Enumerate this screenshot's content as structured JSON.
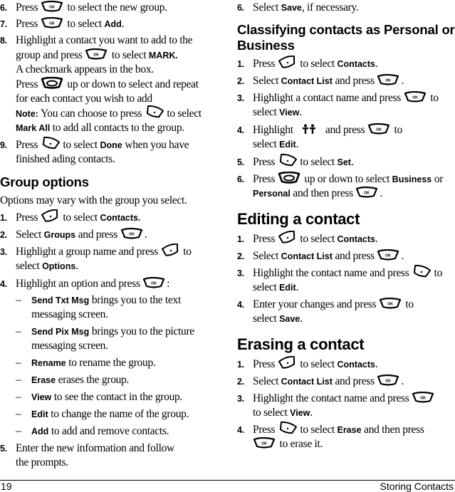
{
  "icons": {
    "ok": "ok-key",
    "left_soft": "left-soft-key",
    "right_soft": "right-soft-key",
    "nav": "navigation-key",
    "contact_type": "contact-type-icon"
  },
  "ok_label": "OK",
  "left_column": {
    "steps_top": [
      {
        "num": "6.",
        "pre": "Press",
        "post": "to select the new group."
      },
      {
        "num": "7.",
        "pre": "Press",
        "post": "to select",
        "bold": "Add",
        "end": "."
      },
      {
        "num": "8.",
        "l1": "Highlight a contact you want to add to the",
        "l2_pre": "group and press",
        "l2_post": "to select",
        "l2_bold": "MARK.",
        "l3": "A checkmark appears in the box.",
        "l4_pre": "Press",
        "l4_post": "up or down to select and repeat",
        "l5": "for each contact you wish to add"
      },
      {
        "note_label": "Note:",
        "note_pre": "You can choose to press",
        "note_post": "to select",
        "note_bold": "Mark All",
        "note_l2": "to add all contacts to the group."
      },
      {
        "num": "9.",
        "pre": "Press",
        "post": "to select",
        "bold": "Done",
        "end": "when you have",
        "l2": "finished ading contacts."
      }
    ],
    "group_options": {
      "heading": "Group options",
      "intro": "Options may vary with the group you select.",
      "steps": [
        {
          "num": "1.",
          "pre": "Press",
          "post": "to select",
          "bold": "Contacts",
          "end": "."
        },
        {
          "num": "2.",
          "pre": "Select",
          "bold": "Groups",
          "post": "and press",
          "end": "."
        },
        {
          "num": "3.",
          "pre": "Highlight a group name and press",
          "post": "to",
          "l2_pre": "select",
          "l2_bold": "Options",
          "l2_end": "."
        },
        {
          "num": "4.",
          "pre": "Highlight an option and press",
          "end": ":"
        }
      ],
      "options": [
        {
          "bold": "Send Txt Msg",
          "text": "brings you to the text",
          "l2": "messaging screen."
        },
        {
          "bold": "Send Pix Msg",
          "text": "brings you to the picture",
          "l2": "messaging screen."
        },
        {
          "bold": "Rename",
          "text": "to rename the group."
        },
        {
          "bold": "Erase",
          "text": "erases the group."
        },
        {
          "bold": "View",
          "text": "to see the contact in the group."
        },
        {
          "bold": "Edit",
          "text": "to change the name of the group."
        },
        {
          "bold": "Add",
          "text": "to add and remove contacts."
        }
      ],
      "step5": {
        "num": "5.",
        "l1": "Enter the new information and follow",
        "l2": "the prompts."
      },
      "dash": "–"
    }
  },
  "right_column": {
    "step6": {
      "num": "6.",
      "pre": "Select",
      "bold": "Save",
      "end": ", if necessary."
    },
    "classifying": {
      "heading_l1": "Classifying contacts as Personal or",
      "heading_l2": "Business",
      "steps": [
        {
          "num": "1.",
          "pre": "Press",
          "post": "to select",
          "bold": "Contacts",
          "end": "."
        },
        {
          "num": "2.",
          "pre": "Select",
          "bold": "Contact List",
          "post": "and press",
          "end": "."
        },
        {
          "num": "3.",
          "pre": "Highlight a contact name and press",
          "post": "to",
          "l2_pre": "select",
          "l2_bold": "View",
          "l2_end": "."
        },
        {
          "num": "4.",
          "pre": "Highlight",
          "mid": "and press",
          "post": "to",
          "l2_pre": "select",
          "l2_bold": "Edit",
          "l2_end": "."
        },
        {
          "num": "5.",
          "pre": "Press",
          "post": "to select",
          "bold": "Set",
          "end": "."
        },
        {
          "num": "6.",
          "pre": "Press",
          "post": "up or down to select",
          "bold": "Business",
          "end": "or",
          "l2_bold": "Personal",
          "l2_mid": "and then press",
          "l2_end": "."
        }
      ]
    },
    "editing": {
      "heading": "Editing a contact",
      "steps": [
        {
          "num": "1.",
          "pre": "Press",
          "post": "to select",
          "bold": "Contacts",
          "end": "."
        },
        {
          "num": "2.",
          "pre": "Select",
          "bold": "Contact List",
          "post": "and press",
          "end": "."
        },
        {
          "num": "3.",
          "pre": "Highlight the contact name and press",
          "post": "to",
          "l2_pre": "select",
          "l2_bold": "Edit",
          "l2_end": "."
        },
        {
          "num": "4.",
          "pre": "Enter your changes and press",
          "post": "to",
          "l2_pre": "select",
          "l2_bold": "Save",
          "l2_end": "."
        }
      ]
    },
    "erasing": {
      "heading": "Erasing a contact",
      "steps": [
        {
          "num": "1.",
          "pre": "Press",
          "post": "to select",
          "bold": "Contacts",
          "end": "."
        },
        {
          "num": "2.",
          "pre": "Select",
          "bold": "Contact List",
          "post": "and press",
          "end": "."
        },
        {
          "num": "3.",
          "pre": "Highlight the contact name and press",
          "l2_pre": "to select",
          "l2_bold": "View",
          "l2_end": "."
        },
        {
          "num": "4.",
          "pre": "Press",
          "post": "to select",
          "bold": "Erase",
          "end": "and then press",
          "l2_post": "to erase it."
        }
      ]
    }
  },
  "footer": {
    "page_number": "19",
    "section_title": "Storing Contacts"
  }
}
